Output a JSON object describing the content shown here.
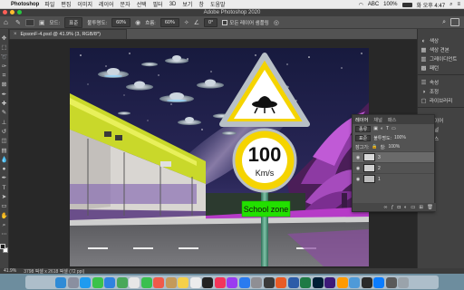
{
  "menubar": {
    "apple_icon": "",
    "app_name": "Photoshop",
    "items": [
      "파일",
      "편집",
      "이미지",
      "레이어",
      "문자",
      "선택",
      "필터",
      "3D",
      "보기",
      "창",
      "도움말"
    ],
    "status": {
      "wifi_icon": "wifi-icon",
      "keyboard": "ABC",
      "battery": "100%",
      "clock": "화 오후 4:47"
    }
  },
  "window": {
    "title": "Adobe Photoshop 2020"
  },
  "options": {
    "mode_label": "모드:",
    "mode_value": "표준",
    "opacity_label": "불투명도:",
    "opacity_value": "60%",
    "flow_label": "흐름:",
    "flow_value": "60%",
    "angle_value": "0°",
    "sample_label": "모든 레이어 샘플링"
  },
  "document": {
    "tab_title": "EpsonF-4.psd @ 41.9% (3, RGB/8*)",
    "close_icon": "×"
  },
  "canvas_signs": {
    "speed_number": "100",
    "speed_unit": "Km/s",
    "plate_text": "School zone"
  },
  "status_bar": {
    "zoom": "41.9%",
    "doc_info": "3798 픽셀 x 2618 픽셀 (72 ppi)"
  },
  "right_panel": {
    "items": [
      {
        "icon": "color-icon",
        "label": "색상"
      },
      {
        "icon": "swatches-icon",
        "label": "색상 견본"
      },
      {
        "icon": "gradient-icon",
        "label": "그레이디언트"
      },
      {
        "icon": "pattern-icon",
        "label": "패턴"
      },
      {
        "icon": "properties-icon",
        "label": "속성"
      },
      {
        "icon": "adjustments-icon",
        "label": "조정"
      },
      {
        "icon": "library-icon",
        "label": "라이브러리"
      },
      {
        "icon": "layers-icon",
        "label": "레이어"
      },
      {
        "icon": "channels-icon",
        "label": "채널"
      },
      {
        "icon": "paths-icon",
        "label": "패스"
      }
    ]
  },
  "layers_panel": {
    "tabs": [
      "레이어",
      "채널",
      "패스"
    ],
    "kind_label": "종류",
    "blend_mode": "표준",
    "opacity_label": "불투명도:",
    "opacity_value": "100%",
    "lock_label": "잠그기:",
    "fill_label": "칠:",
    "fill_value": "100%",
    "layers": [
      {
        "name": "3",
        "selected": true
      },
      {
        "name": "2",
        "selected": false
      },
      {
        "name": "1",
        "selected": false
      }
    ]
  },
  "colors": {
    "accent": "#1473e6",
    "sign_yellow": "#f5d400",
    "plate_green": "#22e000"
  }
}
